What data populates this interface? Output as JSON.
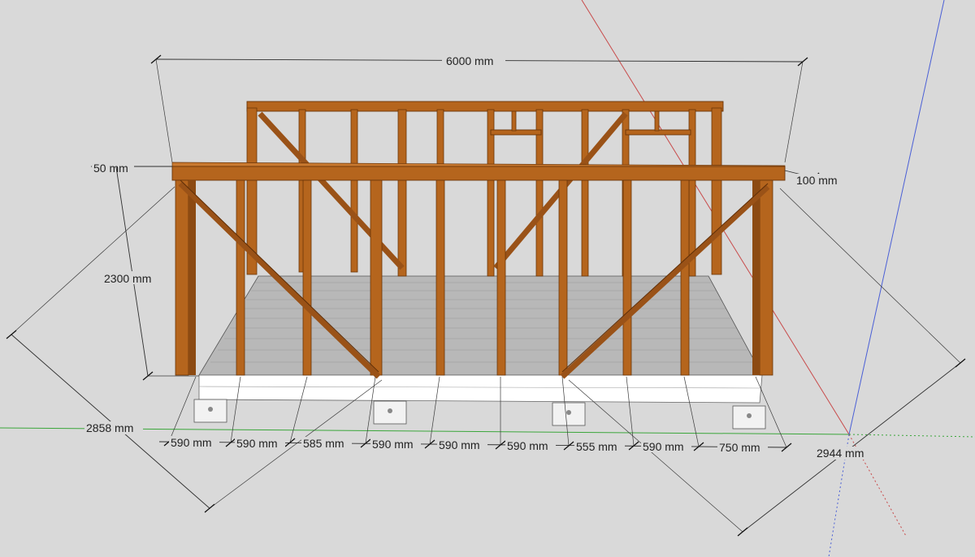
{
  "dimensions": {
    "width": "6000 mm",
    "top_offset": "50 mm",
    "beam_depth": "100 mm",
    "wall_height": "2300 mm",
    "depth_left": "2858 mm",
    "depth_right": "2944 mm",
    "stud_spacing": [
      "590 mm",
      "590 mm",
      "585 mm",
      "590 mm",
      "590 mm",
      "590 mm",
      "555 mm",
      "590 mm",
      "750 mm"
    ]
  },
  "colors": {
    "background": "#d9d9d9",
    "timber": "#b5651d",
    "timber_dark": "#6b3508",
    "deck": "#b8b8b8",
    "axis_red": "#c84a4a",
    "axis_green": "#3aa63a",
    "axis_blue": "#4a5fd6"
  }
}
